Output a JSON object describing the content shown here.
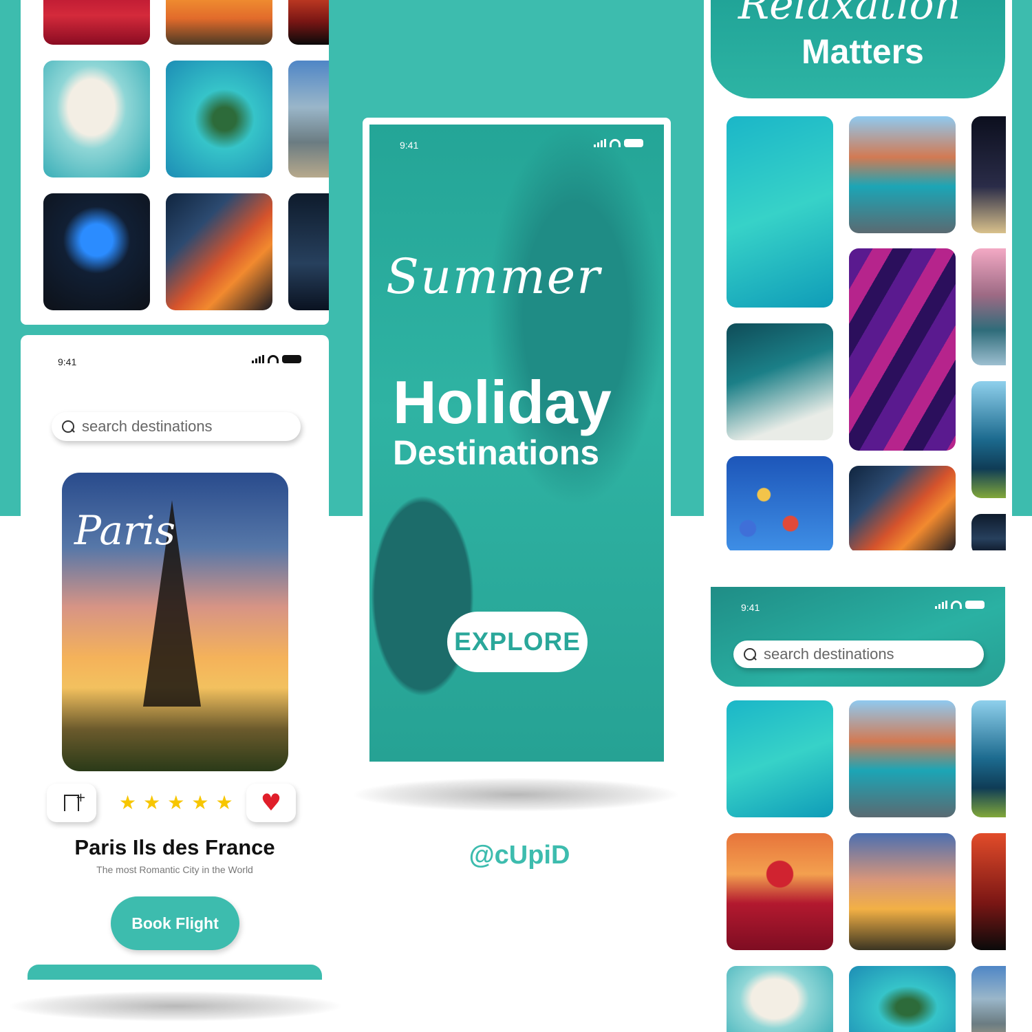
{
  "status_bar": {
    "time": "9:41"
  },
  "detail_screen": {
    "search_placeholder": "search destinations",
    "card_script": "Paris",
    "title": "Paris Ils des France",
    "subtitle": "The most Romantic City in the World",
    "rating_stars": 5,
    "book_button": "Book Flight",
    "icons": [
      "bookmark-add-icon",
      "star-icon",
      "heart-icon",
      "search-icon"
    ]
  },
  "splash_screen": {
    "script_word": "Summer",
    "headline": "Holiday",
    "subheadline": "Destinations",
    "explore_button": "EXPLORE"
  },
  "gallery_screen": {
    "script_word": "Relaxation",
    "headline": "Matters"
  },
  "search_screen": {
    "search_placeholder": "search destinations"
  },
  "watermark": "@cUpiD",
  "colors": {
    "accent": "#3dbcae",
    "star": "#f7c600",
    "heart": "#e01e2a"
  }
}
